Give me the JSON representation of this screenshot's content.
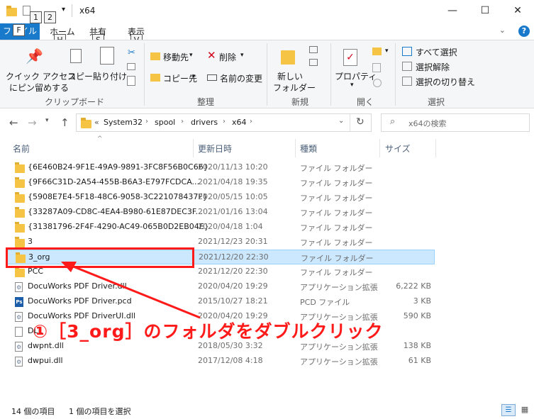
{
  "window": {
    "title": "x64",
    "keytips": [
      "1",
      "2"
    ],
    "controls": {
      "minimize": "—",
      "maximize": "☐",
      "close": "✕"
    }
  },
  "ribbon_tabs": {
    "file": "ファイル",
    "home": "ホーム",
    "share": "共有",
    "view": "表示",
    "keytip_file": "F",
    "keytip_home": "H",
    "keytip_share": "S",
    "keytip_view": "V",
    "help": "?"
  },
  "ribbon": {
    "clipboard": {
      "pin_line1": "クイック アクセス",
      "pin_line2": "にピン留めする",
      "copy": "コピー",
      "paste": "貼り付け",
      "label": "クリップボード"
    },
    "organize": {
      "move_to": "移動先",
      "copy_to": "コピー先",
      "delete": "削除",
      "rename": "名前の変更",
      "label": "整理"
    },
    "new": {
      "new_folder_line1": "新しい",
      "new_folder_line2": "フォルダー",
      "label": "新規"
    },
    "open": {
      "properties": "プロパティ",
      "label": "開く"
    },
    "select": {
      "select_all": "すべて選択",
      "select_none": "選択解除",
      "invert": "選択の切り替え",
      "label": "選択"
    }
  },
  "address": {
    "overflow": "«",
    "crumbs": [
      "System32",
      "spool",
      "drivers",
      "x64"
    ],
    "search_placeholder": "x64の検索"
  },
  "columns": {
    "name": "名前",
    "date": "更新日時",
    "type": "種類",
    "size": "サイズ"
  },
  "files": [
    {
      "name": "{6E460B24-9F1E-49A9-9891-3FC8F56B0C66}",
      "date": "2020/11/13 10:20",
      "type": "ファイル フォルダー",
      "size": "",
      "icon": "folder-icon"
    },
    {
      "name": "{9F66C31D-2A54-455B-B6A3-E797FCDCA...",
      "date": "2021/04/18 19:35",
      "type": "ファイル フォルダー",
      "size": "",
      "icon": "folder-icon"
    },
    {
      "name": "{5908E7E4-5F18-48C6-9058-3C221078437F}",
      "date": "2020/05/15 10:05",
      "type": "ファイル フォルダー",
      "size": "",
      "icon": "folder-icon"
    },
    {
      "name": "{33287A09-CD8C-4EA4-B980-61E87DEC3F...",
      "date": "2021/01/16 13:04",
      "type": "ファイル フォルダー",
      "size": "",
      "icon": "folder-icon"
    },
    {
      "name": "{31381796-2F4F-4290-AC49-065B0D2EB04E}",
      "date": "2020/04/18 1:04",
      "type": "ファイル フォルダー",
      "size": "",
      "icon": "folder-icon"
    },
    {
      "name": "3",
      "date": "2021/12/23 20:31",
      "type": "ファイル フォルダー",
      "size": "",
      "icon": "folder-icon"
    },
    {
      "name": "3_org",
      "date": "2021/12/20 22:30",
      "type": "ファイル フォルダー",
      "size": "",
      "icon": "folder-icon"
    },
    {
      "name": "PCC",
      "date": "2021/12/20 22:30",
      "type": "ファイル フォルダー",
      "size": "",
      "icon": "folder-icon"
    },
    {
      "name": "DocuWorks PDF Driver.dll",
      "date": "2020/04/20 19:29",
      "type": "アプリケーション拡張",
      "size": "6,222 KB",
      "icon": "dll-icon"
    },
    {
      "name": "DocuWorks PDF Driver.pcd",
      "date": "2015/10/27 18:21",
      "type": "PCD ファイル",
      "size": "3 KB",
      "icon": "pcd-icon"
    },
    {
      "name": "DocuWorks PDF DriverUI.dll",
      "date": "2020/04/20 19:29",
      "type": "アプリケーション拡張",
      "size": "590 KB",
      "icon": "dll-icon"
    },
    {
      "name": "DLL",
      "date": "",
      "type": "",
      "size": "",
      "icon": "file-icon"
    },
    {
      "name": "dwpnt.dll",
      "date": "2018/05/30 3:32",
      "type": "アプリケーション拡張",
      "size": "138 KB",
      "icon": "dll-icon"
    },
    {
      "name": "dwpui.dll",
      "date": "2017/12/08 4:18",
      "type": "アプリケーション拡張",
      "size": "61 KB",
      "icon": "dll-icon"
    }
  ],
  "selected_index": 6,
  "annotation": {
    "text": "①［3_org］のフォルダをダブルクリック",
    "color": "#ff1a1a"
  },
  "status": {
    "item_count": "14 個の項目",
    "selected_count": "1 個の項目を選択"
  },
  "colors": {
    "accent": "#1979ca",
    "selection": "#cce8ff",
    "folder": "#f6c445"
  }
}
